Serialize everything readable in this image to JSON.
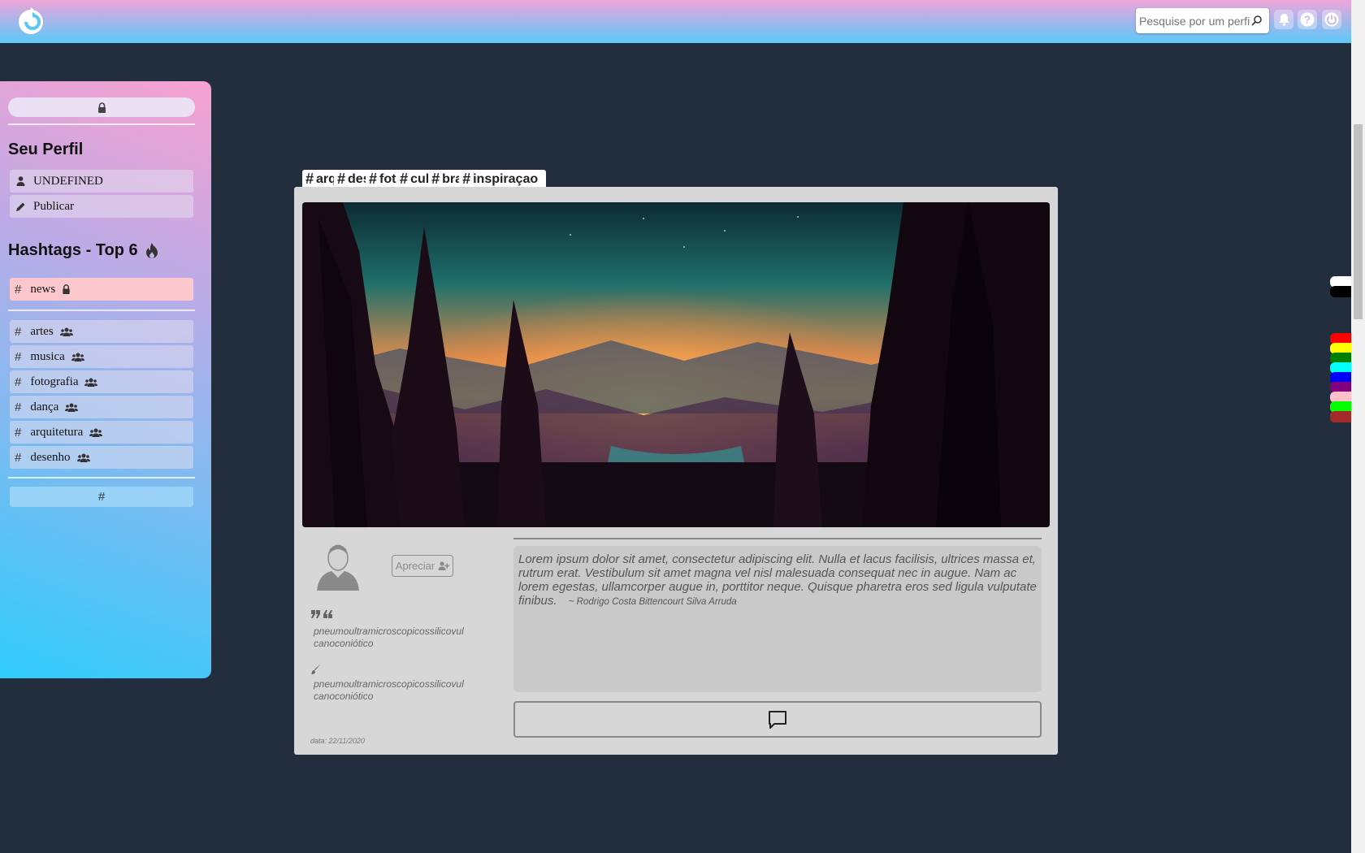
{
  "search": {
    "placeholder": "Pesquise por um perfil"
  },
  "colors": {
    "accent_pink": "#f7a1d0",
    "accent_blue": "#30ccfb",
    "page_bg": "#222e3e",
    "news_bg": "#fcc8ce"
  },
  "sidebar": {
    "profile_title": "Seu Perfil",
    "profile_items": [
      {
        "label": "UNDEFINED",
        "icon": "user-icon"
      },
      {
        "label": "Publicar",
        "icon": "pencil-icon"
      }
    ],
    "hashtags_title": "Hashtags - Top 6",
    "pinned_tag": {
      "label": "news",
      "icon": "lock-icon"
    },
    "hashtags": [
      {
        "label": "artes"
      },
      {
        "label": "musica"
      },
      {
        "label": "fotografia"
      },
      {
        "label": "dança"
      },
      {
        "label": "arquitetura"
      },
      {
        "label": "desenho"
      }
    ],
    "hash_button": "#"
  },
  "post": {
    "tags": [
      {
        "hash": "#",
        "label": "arquitetura"
      },
      {
        "hash": "#",
        "label": "desenho"
      },
      {
        "hash": "#",
        "label": "fotografia"
      },
      {
        "hash": "#",
        "label": "cultura"
      },
      {
        "hash": "#",
        "label": "brasil"
      },
      {
        "hash": "#",
        "label": "inspiraçao"
      }
    ],
    "apreciar_label": "Apreciar",
    "quote_word": "pneumoultramicroscopicossilicovulcanoconiótico",
    "brush_word": "pneumoultramicroscopicossilicovulcanoconiótico",
    "date": "data: 22/11/2020",
    "text": "Lorem ipsum dolor sit amet, consectetur adipiscing elit. Nulla et lacus facilisis, ultrices massa et, rutrum erat. Vestibulum sit amet magna vel nisl malesuada consequat nec in augue. Nam ac lorem egestas, ullamcorper augue in, porttitor neque. Quisque pharetra eros sed ligula vulputate finibus.",
    "author": "~ Rodrigo Costa Bittencourt Silva Arruda"
  },
  "theme_swatches": [
    "#ffffff",
    "#000000",
    "#ff0000",
    "#ffff00",
    "#008000",
    "#00ffff",
    "#0000ff",
    "#800080",
    "#ffc0cb",
    "#00ff00",
    "#ff8c00",
    "#a52a2a"
  ]
}
